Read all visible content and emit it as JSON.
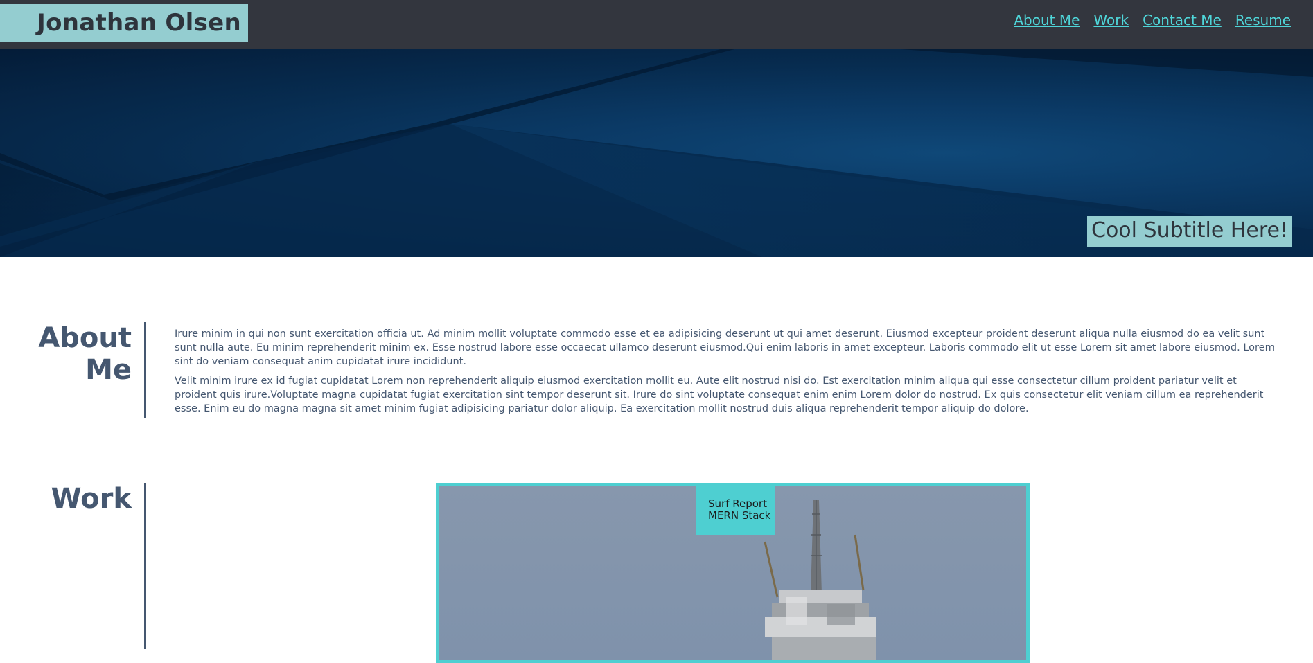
{
  "header": {
    "name": "Jonathan Olsen",
    "nav": [
      {
        "label": "About Me"
      },
      {
        "label": "Work"
      },
      {
        "label": "Contact Me"
      },
      {
        "label": "Resume"
      }
    ]
  },
  "hero": {
    "subtitle": "Cool Subtitle Here!"
  },
  "about": {
    "title": "About Me",
    "paragraphs": [
      "Irure minim in qui non sunt exercitation officia ut. Ad minim mollit voluptate commodo esse et ea adipisicing deserunt ut qui amet deserunt. Eiusmod excepteur proident deserunt aliqua nulla eiusmod do ea velit sunt sunt nulla aute. Eu minim reprehenderit minim ex. Esse nostrud labore esse occaecat ullamco deserunt eiusmod.Qui enim laboris in amet excepteur. Laboris commodo elit ut esse Lorem sit amet labore eiusmod. Lorem sint do veniam consequat anim cupidatat irure incididunt.",
      "Velit minim irure ex id fugiat cupidatat Lorem non reprehenderit aliquip eiusmod exercitation mollit eu. Aute elit nostrud nisi do. Est exercitation minim aliqua qui esse consectetur cillum proident pariatur velit et proident quis irure.Voluptate magna cupidatat fugiat exercitation sint tempor deserunt sit. Irure do sint voluptate consequat enim enim Lorem dolor do nostrud. Ex quis consectetur elit veniam cillum ea reprehenderit esse. Enim eu do magna magna sit amet minim fugiat adipisicing pariatur dolor aliquip. Ea exercitation mollit nostrud duis aliqua reprehenderit tempor aliquip do dolore."
    ]
  },
  "work": {
    "title": "Work",
    "projects": [
      {
        "name": "Surf Report",
        "stack": "MERN Stack"
      }
    ]
  },
  "colors": {
    "topbar": "#33363e",
    "accent_teal": "#4ecfd1",
    "name_block": "#94cdd0",
    "section_text": "#455770"
  }
}
